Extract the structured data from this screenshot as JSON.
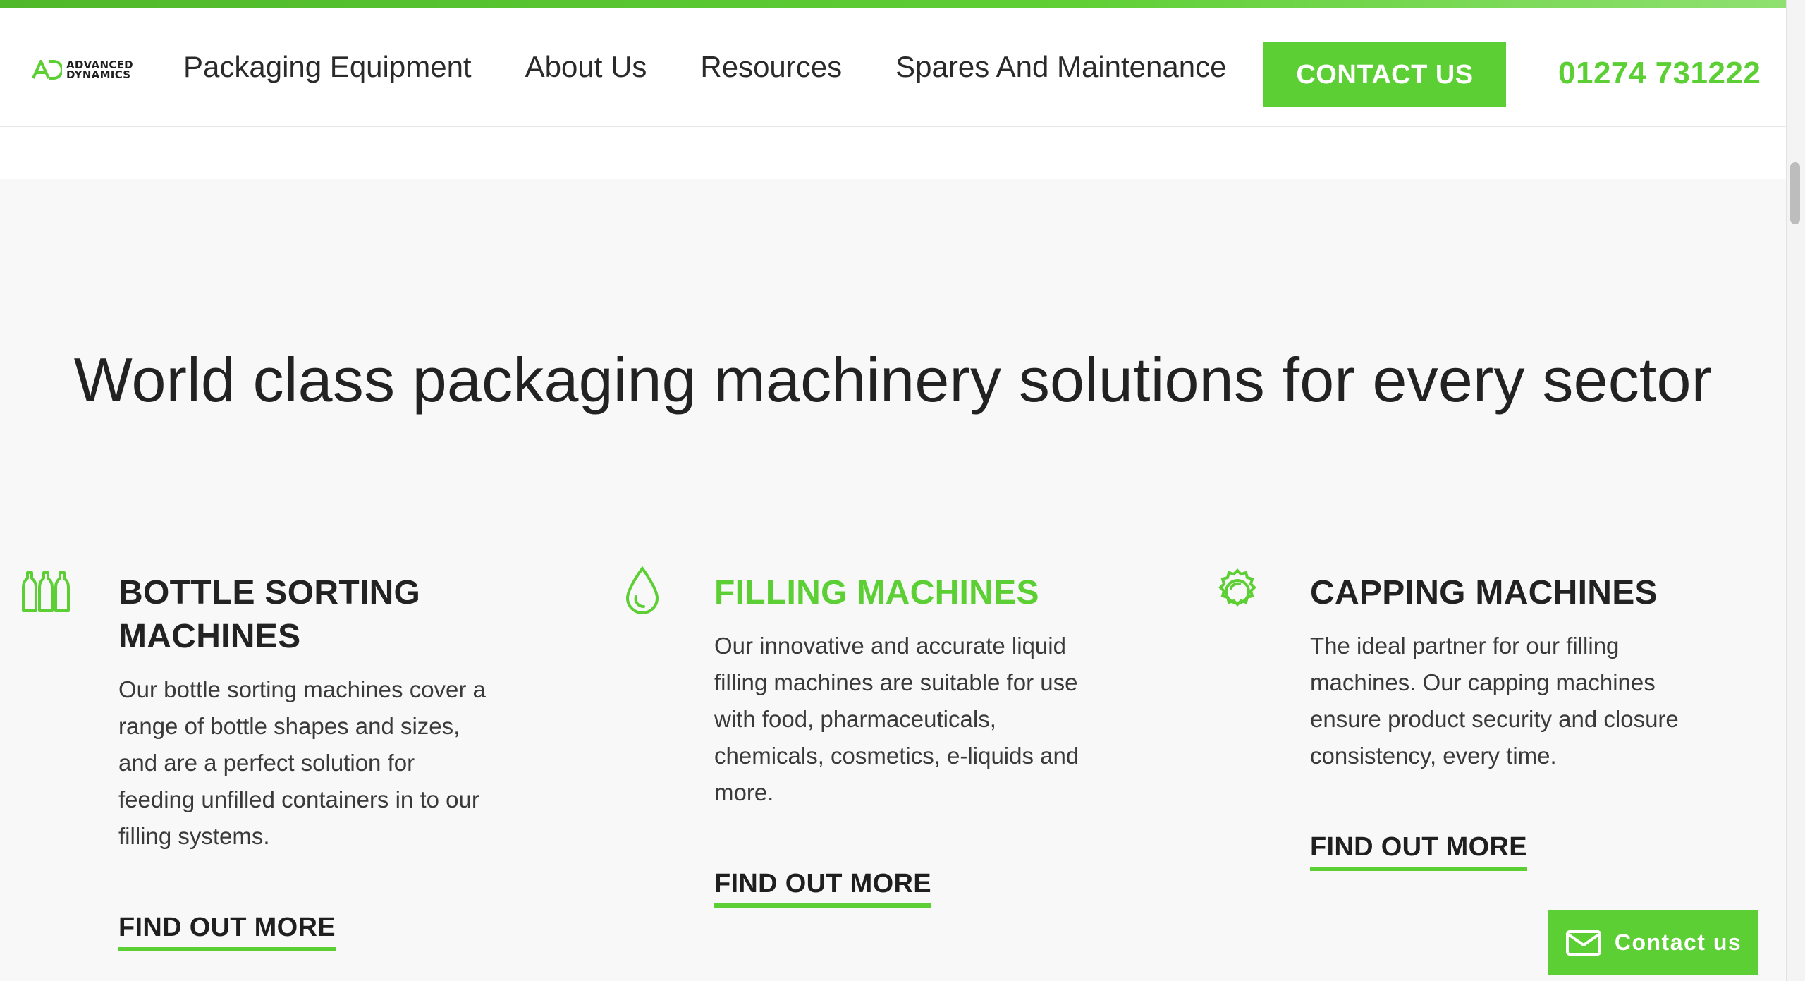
{
  "header": {
    "logo_text_line1": "ADVANCED",
    "logo_text_line2": "DYNAMICS",
    "nav": [
      {
        "label": "Packaging Equipment"
      },
      {
        "label": "About Us"
      },
      {
        "label": "Resources"
      },
      {
        "label": "Spares And Maintenance"
      }
    ],
    "cta_label": "CONTACT US",
    "phone": "01274 731222"
  },
  "hero": {
    "headline": "World class packaging machinery solutions for every sector"
  },
  "features": [
    {
      "icon": "bottles-icon",
      "title": "BOTTLE SORTING MACHINES",
      "description": "Our bottle sorting machines cover a range of bottle shapes and sizes, and are a perfect solution for feeding unfilled containers in to our filling systems.",
      "link_label": "FIND OUT MORE"
    },
    {
      "icon": "droplet-icon",
      "title": "FILLING MACHINES",
      "description": "Our innovative and accurate liquid filling machines are suitable for use with food, pharmaceuticals, chemicals, cosmetics, e-liquids and more.",
      "link_label": "FIND OUT MORE"
    },
    {
      "icon": "bottle-cap-icon",
      "title": "CAPPING MACHINES",
      "description": "The ideal partner for our filling machines. Our capping machines ensure product security and closure consistency, every time.",
      "link_label": "FIND OUT MORE"
    }
  ],
  "floating_contact": {
    "label": "Contact us",
    "icon": "envelope-icon"
  },
  "colors": {
    "brand_green": "#5ccf34",
    "text_dark": "#222222",
    "section_bg": "#f8f8f8"
  }
}
